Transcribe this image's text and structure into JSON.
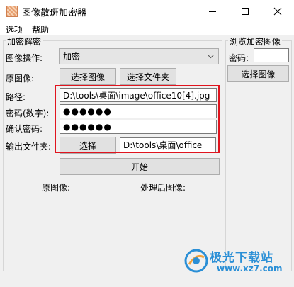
{
  "window": {
    "title": "图像散斑加密器"
  },
  "menu": {
    "items": [
      "选项",
      "帮助"
    ]
  },
  "encrypt_group": {
    "title": "加密解密",
    "operation_label": "图像操作:",
    "operation_value": "加密",
    "original_label": "原图像:",
    "select_image_button": "选择图像",
    "select_folder_button": "选择文件夹",
    "path_label": "路径:",
    "path_value": "D:\\tools\\桌面\\image\\office10[4].jpg",
    "password_label": "密码(数字):",
    "password_value": "●●●●●●",
    "confirm_label": "确认密码:",
    "confirm_value": "●●●●●●",
    "output_label": "输出文件夹:",
    "output_select_button": "选择",
    "output_value": "D:\\tools\\桌面\\office",
    "start_button": "开始",
    "original_image_label": "原图像:",
    "processed_image_label": "处理后图像:"
  },
  "browse_group": {
    "title": "浏览加密图像",
    "password_label": "密码:",
    "password_value": "",
    "select_image_button": "选择图像"
  },
  "watermark": {
    "brand": "极光下载站",
    "url": "www.xz7.com"
  },
  "colors": {
    "highlight": "#e0141e",
    "watermark": "#2a8fd6"
  }
}
